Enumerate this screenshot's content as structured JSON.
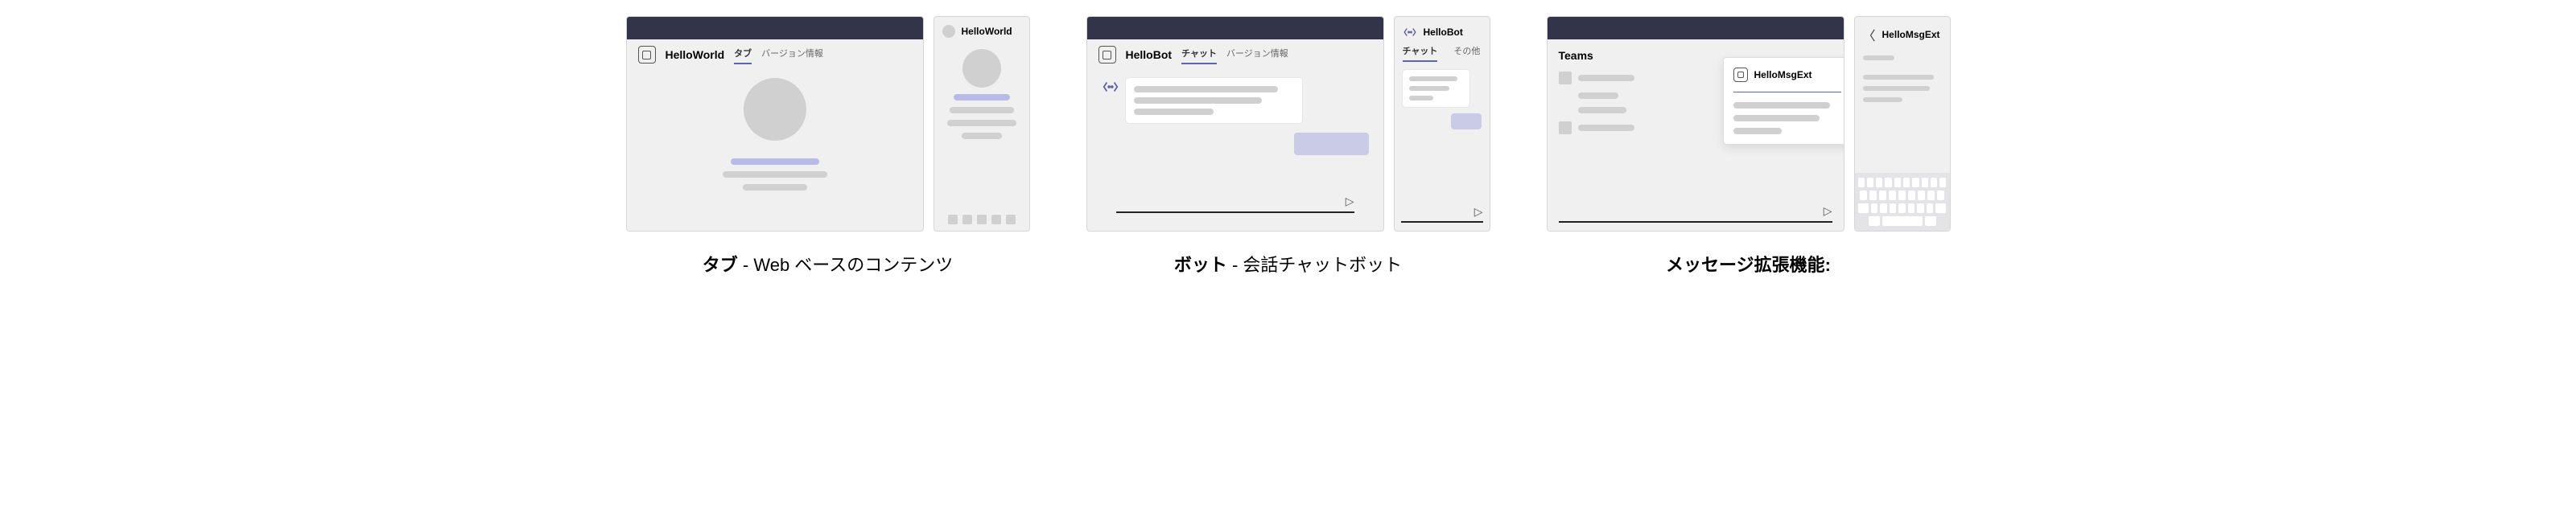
{
  "captions": {
    "tab_bold": "タブ",
    "tab_rest": " - Web ベースのコンテンツ",
    "bot_bold": "ボット",
    "bot_rest": " - 会話チャットボット",
    "msgext_bold": "メッセージ拡張機能:"
  },
  "apps": {
    "helloworld": {
      "name": "HelloWorld"
    },
    "hellobot": {
      "name": "HelloBot"
    },
    "hellomsgext": {
      "name": "HelloMsgExt"
    }
  },
  "tabs": {
    "tab": "タブ",
    "version_info": "バージョン情報",
    "chat": "チャット",
    "other": "その他"
  },
  "labels": {
    "teams": "Teams"
  },
  "icons": {
    "send": "▷",
    "back": "〈"
  }
}
